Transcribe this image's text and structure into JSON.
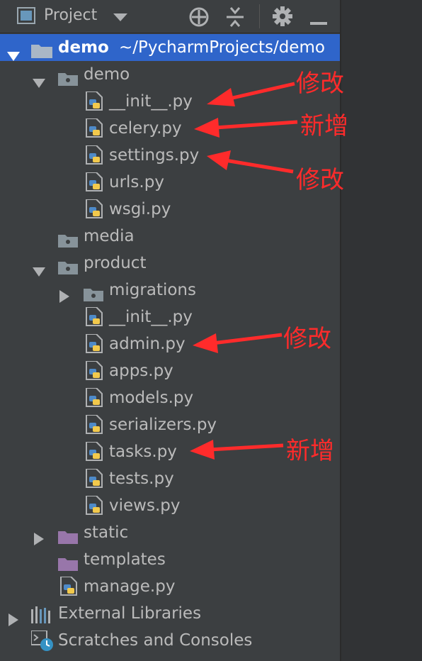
{
  "toolbar": {
    "title": "Project",
    "icons": [
      "project-panel-icon",
      "dropdown-icon",
      "locate-icon",
      "collapse-icon",
      "settings-icon",
      "hide-icon"
    ]
  },
  "tree": {
    "root": {
      "name": "demo",
      "path": "~/PycharmProjects/demo"
    },
    "demo_pkg": {
      "name": "demo",
      "files": [
        "__init__.py",
        "celery.py",
        "settings.py",
        "urls.py",
        "wsgi.py"
      ]
    },
    "media": "media",
    "product": {
      "name": "product",
      "migrations": "migrations",
      "files": [
        "__init__.py",
        "admin.py",
        "apps.py",
        "models.py",
        "serializers.py",
        "tasks.py",
        "tests.py",
        "views.py"
      ]
    },
    "static": "static",
    "templates": "templates",
    "manage": "manage.py",
    "external": "External Libraries",
    "scratches": "Scratches and Consoles"
  },
  "annotations": {
    "init_demo": "修改",
    "celery": "新增",
    "settings": "修改",
    "admin": "修改",
    "tasks": "新增",
    "color": "#ff2b2b"
  },
  "colors": {
    "background": "#3c3f41",
    "selection": "#2f65ca",
    "text": "#bbbbbb",
    "folder": "#87939a",
    "folder_resource": "#9876aa"
  }
}
